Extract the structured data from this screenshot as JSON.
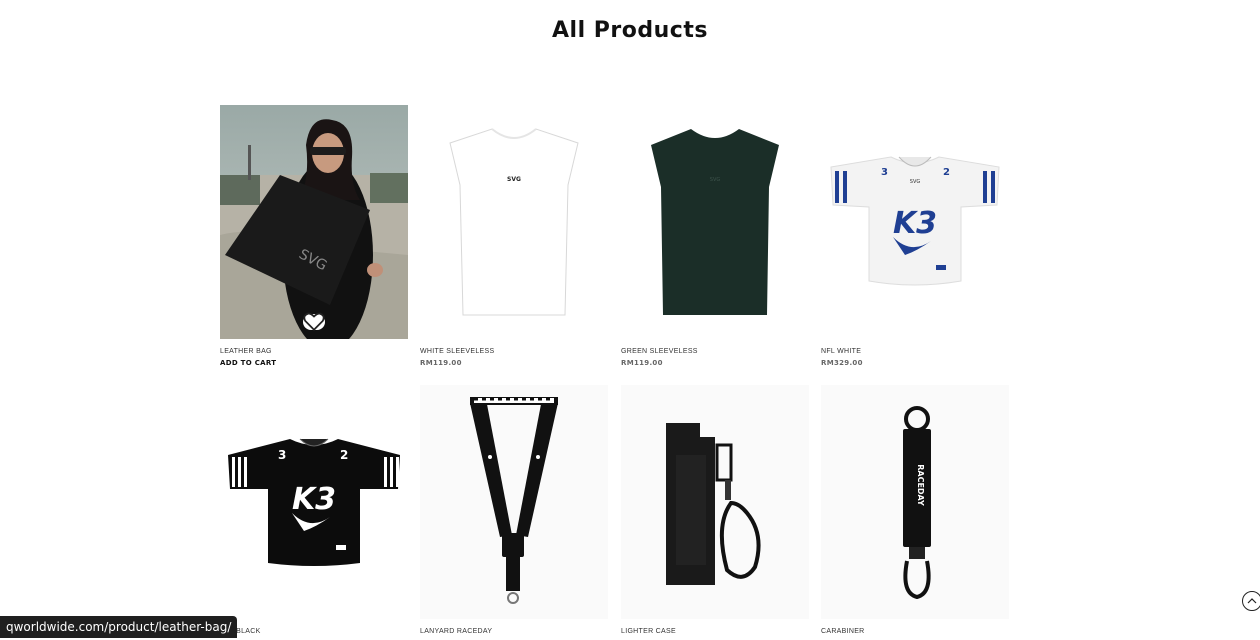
{
  "page": {
    "title": "All Products"
  },
  "products": [
    {
      "name": "LEATHER BAG",
      "action": "ADD TO CART",
      "image": "leather-bag-model-photo"
    },
    {
      "name": "WHITE SLEEVELESS",
      "price": "RM119.00",
      "image": "white-sleeveless-shirt"
    },
    {
      "name": "GREEN SLEEVELESS",
      "price": "RM119.00",
      "image": "green-sleeveless-shirt"
    },
    {
      "name": "NFL WHITE",
      "price": "RM329.00",
      "image": "nfl-white-jersey",
      "print_text": "K3"
    },
    {
      "name": "NFL BLACK",
      "image": "nfl-black-jersey",
      "print_text": "K3"
    },
    {
      "name": "LANYARD RACEDAY",
      "image": "lanyard-raceday"
    },
    {
      "name": "LIGHTER CASE",
      "image": "lighter-case"
    },
    {
      "name": "CARABINER",
      "image": "carabiner"
    }
  ],
  "brand_mark": "SVG",
  "status_bar": {
    "url": "qworldwide.com/product/leather-bag/"
  },
  "icons": {
    "wishlist": "heart-icon",
    "scroll_top": "chevron-up-icon"
  },
  "colors": {
    "text": "#111111",
    "price": "#666666",
    "green_shirt": "#1b2e28",
    "jersey_blue": "#1f3f93"
  }
}
